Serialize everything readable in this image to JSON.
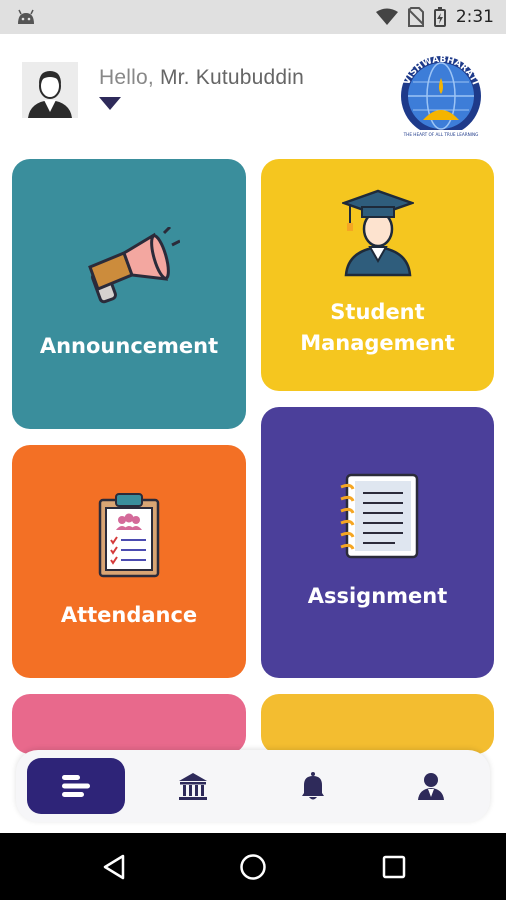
{
  "status_bar": {
    "time": "2:31",
    "icons": [
      "android-icon",
      "wifi-icon",
      "no-sim-icon",
      "battery-charging-icon"
    ]
  },
  "header": {
    "greeting": "Hello,",
    "user_name": "Mr. Kutubuddin",
    "logo_text_top": "VISHWABHARATI",
    "logo_tagline": "THE HEART OF ALL TRUE LEARNING"
  },
  "cards": {
    "announcement": "Announcement",
    "student_line1": "Student",
    "student_line2": "Management",
    "attendance": "Attendance",
    "assignment": "Assignment"
  },
  "colors": {
    "announcement": "#3a8e9c",
    "student": "#f5c61f",
    "attendance": "#f37025",
    "assignment": "#4b3f9a",
    "pink": "#e8698c",
    "yellow": "#f3bd30",
    "nav_active": "#2e2478"
  },
  "bottom_nav": {
    "items": [
      "menu-icon",
      "institution-icon",
      "bell-icon",
      "profile-icon"
    ],
    "active_index": 0
  },
  "system_nav": [
    "back-icon",
    "home-icon",
    "recents-icon"
  ]
}
